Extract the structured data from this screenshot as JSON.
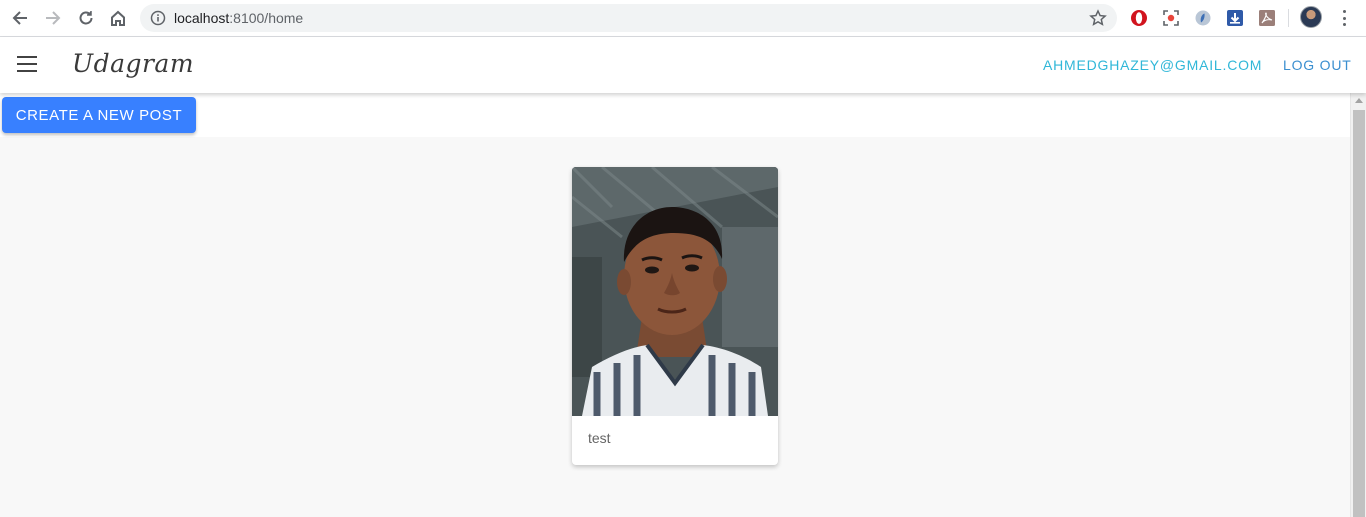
{
  "browser": {
    "url_host": "localhost",
    "url_rest": ":8100/home",
    "icons": [
      "back-arrow-icon",
      "forward-arrow-icon",
      "reload-icon",
      "home-icon",
      "info-icon",
      "star-icon",
      "opera-icon",
      "screenshot-icon",
      "extension-icon",
      "download-icon",
      "pdf-icon",
      "profile-avatar",
      "more-menu-icon"
    ]
  },
  "header": {
    "brand": "Udagram",
    "email": "AHMEDGHAZEY@GMAIL.COM",
    "logout": "LOG OUT",
    "menu_icon": "hamburger-menu-icon"
  },
  "actions": {
    "create_post": "CREATE A NEW POST"
  },
  "feed": {
    "items": [
      {
        "caption": "test",
        "image": "portrait-photo"
      }
    ]
  },
  "colors": {
    "primary_button": "#3880ff",
    "email_link": "#30b7d8",
    "logout_link": "#3b8fd0",
    "page_background": "#f8f8f8"
  }
}
